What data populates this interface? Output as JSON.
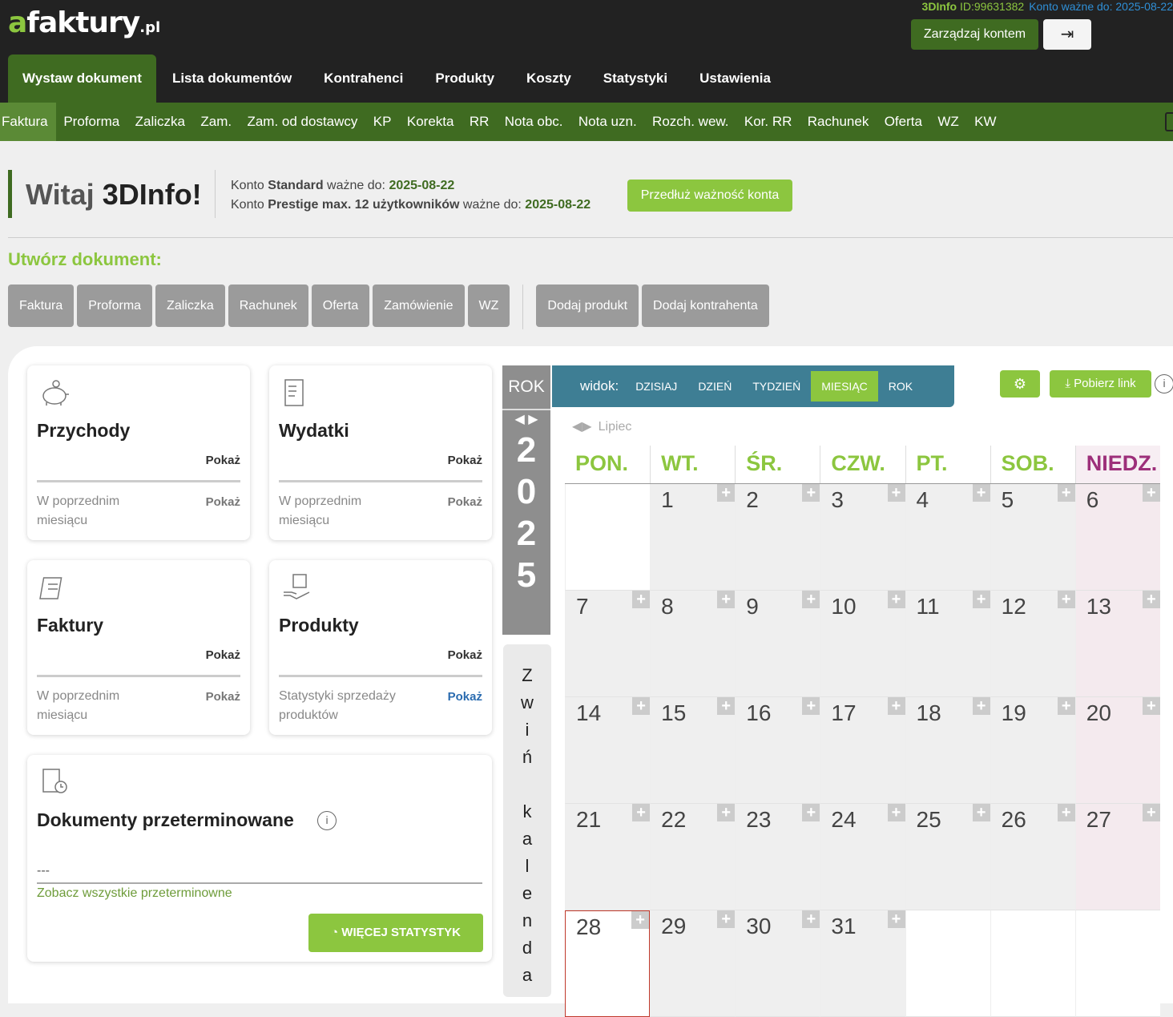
{
  "header": {
    "logo_a": "a",
    "logo_main": "faktury",
    "logo_pl": ".pl",
    "account_name": "3DInfo",
    "account_id": "ID:99631382",
    "account_valid": "Konto ważne do: 2025-08-22",
    "manage_label": "Zarządzaj kontem",
    "logout_glyph": "⇥"
  },
  "nav": [
    "Wystaw dokument",
    "Lista dokumentów",
    "Kontrahenci",
    "Produkty",
    "Koszty",
    "Statystyki",
    "Ustawienia"
  ],
  "subnav": [
    "Faktura",
    "Proforma",
    "Zaliczka",
    "Zam.",
    "Zam. od dostawcy",
    "KP",
    "Korekta",
    "RR",
    "Nota obc.",
    "Nota uzn.",
    "Rozch. wew.",
    "Kor. RR",
    "Rachunek",
    "Oferta",
    "WZ",
    "KW"
  ],
  "welcome": {
    "prefix": "Witaj ",
    "name": "3DInfo!",
    "line1_a": "Konto ",
    "line1_b": "Standard",
    "line1_c": " ważne do: ",
    "line1_date": "2025-08-22",
    "line2_a": "Konto ",
    "line2_b": "Prestige max. 12 użytkowników",
    "line2_c": " ważne do: ",
    "line2_date": "2025-08-22",
    "extend_label": "Przedłuż ważność konta"
  },
  "create": {
    "title": "Utwórz dokument:",
    "docs": [
      "Faktura",
      "Proforma",
      "Zaliczka",
      "Rachunek",
      "Oferta",
      "Zamówienie",
      "WZ"
    ],
    "extra": [
      "Dodaj produkt",
      "Dodaj kontrahenta"
    ]
  },
  "cards": {
    "przychody": {
      "title": "Przychody",
      "show": "Pokaż",
      "prev": "W poprzednim miesiącu",
      "prev_show": "Pokaż"
    },
    "wydatki": {
      "title": "Wydatki",
      "show": "Pokaż",
      "prev": "W poprzednim miesiącu",
      "prev_show": "Pokaż"
    },
    "faktury": {
      "title": "Faktury",
      "show": "Pokaż",
      "prev": "W poprzednim miesiącu",
      "prev_show": "Pokaż"
    },
    "produkty": {
      "title": "Produkty",
      "show": "Pokaż",
      "prev": "Statystyki sprzedaży produktów",
      "prev_show": "Pokaż"
    },
    "overdue": {
      "title": "Dokumenty przeterminowane",
      "value": "---",
      "link": "Zobacz wszystkie przeterminowne",
      "stats_button": "WIĘCEJ STATYSTYK"
    }
  },
  "calendar": {
    "rok_label": "ROK",
    "year_digits": [
      "2",
      "0",
      "2",
      "5"
    ],
    "collapse_letters": [
      "Z",
      "w",
      "i",
      "ń",
      "",
      "k",
      "a",
      "l",
      "e",
      "n",
      "d",
      "a"
    ],
    "view_label": "widok:",
    "views": [
      "DZISIAJ",
      "DZIEŃ",
      "TYDZIEŃ",
      "MIESIĄC",
      "ROK"
    ],
    "active_view": "MIESIĄC",
    "download_label": "Pobierz link",
    "month": "Lipiec",
    "days": [
      "PON.",
      "WT.",
      "ŚR.",
      "CZW.",
      "PT.",
      "SOB.",
      "NIEDZ."
    ],
    "weeks": [
      [
        "",
        "1",
        "2",
        "3",
        "4",
        "5",
        "6"
      ],
      [
        "7",
        "8",
        "9",
        "10",
        "11",
        "12",
        "13"
      ],
      [
        "14",
        "15",
        "16",
        "17",
        "18",
        "19",
        "20"
      ],
      [
        "21",
        "22",
        "23",
        "24",
        "25",
        "26",
        "27"
      ],
      [
        "28",
        "29",
        "30",
        "31",
        "",
        "",
        ""
      ]
    ],
    "today": "28"
  }
}
